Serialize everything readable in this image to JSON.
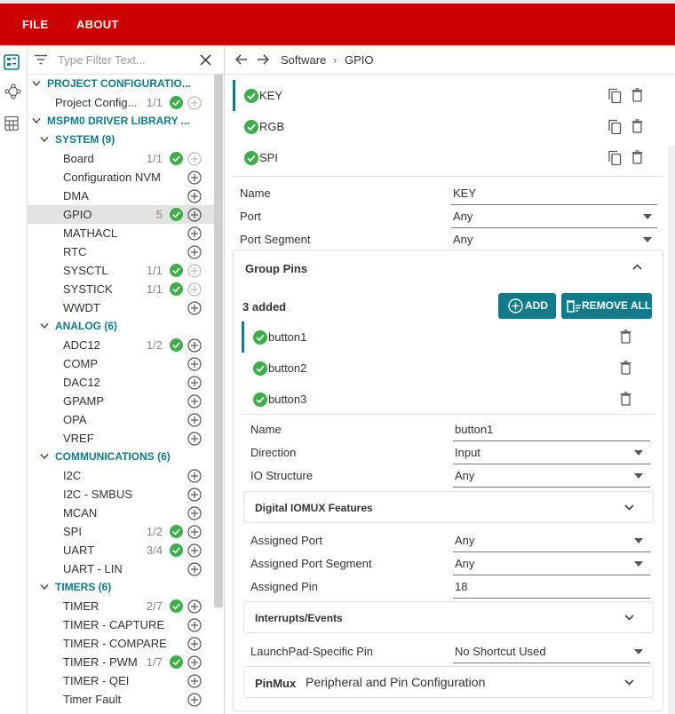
{
  "menu": {
    "file": "FILE",
    "about": "ABOUT"
  },
  "colors": {
    "brand_red": "#cc0000",
    "accent_teal": "#117a8b",
    "ok_green": "#3dae4a"
  },
  "filter": {
    "placeholder": "Type Filter Text..."
  },
  "breadcrumb": {
    "root": "Software",
    "separator": "›",
    "current": "GPIO"
  },
  "tree": {
    "rows": [
      {
        "kind": "cat",
        "level": 0,
        "label": "PROJECT CONFIGURATIO...",
        "expanded": true
      },
      {
        "kind": "item",
        "level": 1,
        "label": "Project Config...",
        "count": "1/1",
        "ok": true,
        "add_enabled": false
      },
      {
        "kind": "cat",
        "level": 0,
        "label": "MSPM0 DRIVER LIBRARY ...",
        "expanded": true
      },
      {
        "kind": "cat",
        "level": 1,
        "label": "SYSTEM (9)",
        "expanded": true
      },
      {
        "kind": "item",
        "level": 2,
        "label": "Board",
        "count": "1/1",
        "ok": true,
        "add_enabled": false
      },
      {
        "kind": "item",
        "level": 2,
        "label": "Configuration NVM",
        "count": "",
        "ok": false,
        "add_enabled": true
      },
      {
        "kind": "item",
        "level": 2,
        "label": "DMA",
        "count": "",
        "ok": false,
        "add_enabled": true
      },
      {
        "kind": "item",
        "level": 2,
        "label": "GPIO",
        "count": "5",
        "ok": true,
        "add_enabled": true,
        "selected": true
      },
      {
        "kind": "item",
        "level": 2,
        "label": "MATHACL",
        "count": "",
        "ok": false,
        "add_enabled": true
      },
      {
        "kind": "item",
        "level": 2,
        "label": "RTC",
        "count": "",
        "ok": false,
        "add_enabled": true
      },
      {
        "kind": "item",
        "level": 2,
        "label": "SYSCTL",
        "count": "1/1",
        "ok": true,
        "add_enabled": false
      },
      {
        "kind": "item",
        "level": 2,
        "label": "SYSTICK",
        "count": "1/1",
        "ok": true,
        "add_enabled": false
      },
      {
        "kind": "item",
        "level": 2,
        "label": "WWDT",
        "count": "",
        "ok": false,
        "add_enabled": true
      },
      {
        "kind": "cat",
        "level": 1,
        "label": "ANALOG (6)",
        "expanded": true
      },
      {
        "kind": "item",
        "level": 2,
        "label": "ADC12",
        "count": "1/2",
        "ok": true,
        "add_enabled": true
      },
      {
        "kind": "item",
        "level": 2,
        "label": "COMP",
        "count": "",
        "ok": false,
        "add_enabled": true
      },
      {
        "kind": "item",
        "level": 2,
        "label": "DAC12",
        "count": "",
        "ok": false,
        "add_enabled": true
      },
      {
        "kind": "item",
        "level": 2,
        "label": "GPAMP",
        "count": "",
        "ok": false,
        "add_enabled": true
      },
      {
        "kind": "item",
        "level": 2,
        "label": "OPA",
        "count": "",
        "ok": false,
        "add_enabled": true
      },
      {
        "kind": "item",
        "level": 2,
        "label": "VREF",
        "count": "",
        "ok": false,
        "add_enabled": true
      },
      {
        "kind": "cat",
        "level": 1,
        "label": "COMMUNICATIONS (6)",
        "expanded": true
      },
      {
        "kind": "item",
        "level": 2,
        "label": "I2C",
        "count": "",
        "ok": false,
        "add_enabled": true
      },
      {
        "kind": "item",
        "level": 2,
        "label": "I2C - SMBUS",
        "count": "",
        "ok": false,
        "add_enabled": true
      },
      {
        "kind": "item",
        "level": 2,
        "label": "MCAN",
        "count": "",
        "ok": false,
        "add_enabled": true
      },
      {
        "kind": "item",
        "level": 2,
        "label": "SPI",
        "count": "1/2",
        "ok": true,
        "add_enabled": true
      },
      {
        "kind": "item",
        "level": 2,
        "label": "UART",
        "count": "3/4",
        "ok": true,
        "add_enabled": true
      },
      {
        "kind": "item",
        "level": 2,
        "label": "UART - LIN",
        "count": "",
        "ok": false,
        "add_enabled": true
      },
      {
        "kind": "cat",
        "level": 1,
        "label": "TIMERS (6)",
        "expanded": true
      },
      {
        "kind": "item",
        "level": 2,
        "label": "TIMER",
        "count": "2/7",
        "ok": true,
        "add_enabled": true
      },
      {
        "kind": "item",
        "level": 2,
        "label": "TIMER - CAPTURE",
        "count": "",
        "ok": false,
        "add_enabled": true
      },
      {
        "kind": "item",
        "level": 2,
        "label": "TIMER - COMPARE",
        "count": "",
        "ok": false,
        "add_enabled": true
      },
      {
        "kind": "item",
        "level": 2,
        "label": "TIMER - PWM",
        "count": "1/7",
        "ok": true,
        "add_enabled": true
      },
      {
        "kind": "item",
        "level": 2,
        "label": "TIMER - QEI",
        "count": "",
        "ok": false,
        "add_enabled": true
      },
      {
        "kind": "item",
        "level": 2,
        "label": "Timer Fault",
        "count": "",
        "ok": false,
        "add_enabled": true
      }
    ]
  },
  "instances": [
    {
      "name": "KEY",
      "selected": true
    },
    {
      "name": "RGB",
      "selected": false
    },
    {
      "name": "SPI",
      "selected": false
    }
  ],
  "instance_fields": {
    "name_label": "Name",
    "name_value": "KEY",
    "port_label": "Port",
    "port_value": "Any",
    "segment_label": "Port Segment",
    "segment_value": "Any"
  },
  "group_pins": {
    "title": "Group Pins",
    "added_count": "3 added",
    "add_label": "ADD",
    "remove_all_label": "REMOVE ALL",
    "pins": [
      {
        "name": "button1",
        "selected": true
      },
      {
        "name": "button2",
        "selected": false
      },
      {
        "name": "button3",
        "selected": false
      }
    ],
    "fields": {
      "name_label": "Name",
      "name_value": "button1",
      "direction_label": "Direction",
      "direction_value": "Input",
      "io_label": "IO Structure",
      "io_value": "Any"
    },
    "iomux_title": "Digital IOMUX Features",
    "assigned": {
      "port_label": "Assigned Port",
      "port_value": "Any",
      "segment_label": "Assigned Port Segment",
      "segment_value": "Any",
      "pin_label": "Assigned Pin",
      "pin_value": "18"
    },
    "interrupts_title": "Interrupts/Events",
    "launchpad_label": "LaunchPad-Specific Pin",
    "launchpad_value": "No Shortcut Used",
    "pinmux_title": "PinMux",
    "pinmux_desc": "Peripheral and Pin Configuration"
  }
}
